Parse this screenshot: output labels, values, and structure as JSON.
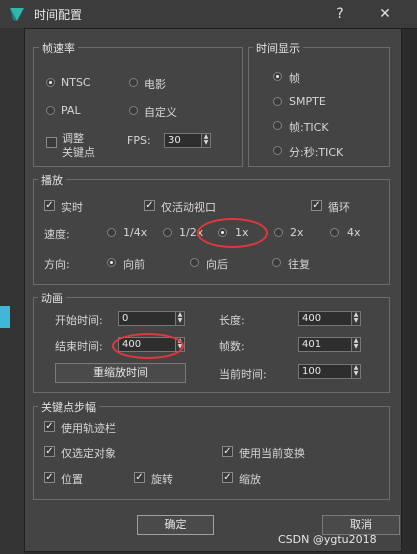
{
  "window": {
    "title": "时间配置",
    "help": "?",
    "close": "✕"
  },
  "frame_rate": {
    "legend": "帧速率",
    "options": [
      "NTSC",
      "电影",
      "PAL",
      "自定义"
    ],
    "selected": "NTSC",
    "adjust_keys_line1": "调整",
    "adjust_keys_line2": "关键点",
    "fps_label": "FPS:",
    "fps_value": "30"
  },
  "time_display": {
    "legend": "时间显示",
    "options": [
      "帧",
      "SMPTE",
      "帧:TICK",
      "分:秒:TICK"
    ],
    "selected": "帧"
  },
  "playback": {
    "legend": "播放",
    "realtime": "实时",
    "active_viewport_only": "仅活动视口",
    "loop": "循环",
    "speed_label": "速度:",
    "speeds": [
      "1/4x",
      "1/2x",
      "1x",
      "2x",
      "4x"
    ],
    "speed_selected": "1x",
    "direction_label": "方向:",
    "directions": [
      "向前",
      "向后",
      "往复"
    ],
    "direction_selected": "向前"
  },
  "animation": {
    "legend": "动画",
    "start_label": "开始时间:",
    "start_value": "0",
    "end_label": "结束时间:",
    "end_value": "400",
    "length_label": "长度:",
    "length_value": "400",
    "frames_label": "帧数:",
    "frames_value": "401",
    "rescale_button": "重缩放时间",
    "current_label": "当前时间:",
    "current_value": "100"
  },
  "key_steps": {
    "legend": "关键点步幅",
    "use_trackbar": "使用轨迹栏",
    "selected_only": "仅选定对象",
    "use_current_transform": "使用当前变换",
    "position": "位置",
    "rotation": "旋转",
    "scale": "缩放"
  },
  "buttons": {
    "ok": "确定",
    "cancel": "取消"
  },
  "watermark": "CSDN @ygtu2018",
  "colors": {
    "annotation": "#e0393b",
    "app_icon": "#2fb7b0"
  }
}
